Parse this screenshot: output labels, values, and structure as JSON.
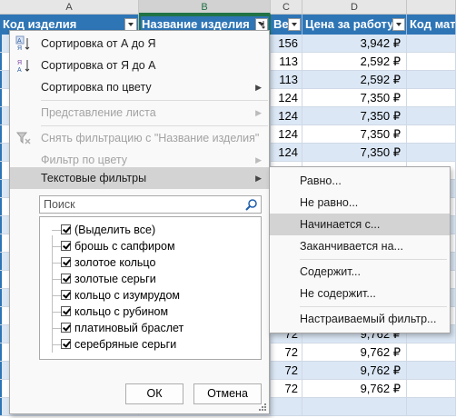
{
  "columns": {
    "letters": [
      "A",
      "B",
      "C",
      "D",
      ""
    ],
    "headers": [
      "Код изделия",
      "Название изделия",
      "Ве",
      "Цена за работу",
      "Код мат"
    ]
  },
  "rows": [
    {
      "c": "156",
      "d": "3,942 ₽"
    },
    {
      "c": "113",
      "d": "2,592 ₽"
    },
    {
      "c": "113",
      "d": "2,592 ₽"
    },
    {
      "c": "124",
      "d": "7,350 ₽"
    },
    {
      "c": "124",
      "d": "7,350 ₽"
    },
    {
      "c": "124",
      "d": "7,350 ₽"
    },
    {
      "c": "124",
      "d": "7,350 ₽"
    },
    {
      "c": "",
      "d": ""
    },
    {
      "c": "",
      "d": ""
    },
    {
      "c": "",
      "d": ""
    },
    {
      "c": "",
      "d": ""
    },
    {
      "c": "",
      "d": ""
    },
    {
      "c": "",
      "d": ""
    },
    {
      "c": "",
      "d": ""
    },
    {
      "c": "",
      "d": ""
    },
    {
      "c": "",
      "d": ""
    },
    {
      "c": "72",
      "d": "9,762 ₽"
    },
    {
      "c": "72",
      "d": "9,762 ₽"
    },
    {
      "c": "72",
      "d": "9,762 ₽"
    },
    {
      "c": "72",
      "d": "9,762 ₽"
    },
    {
      "c": "",
      "d": ""
    }
  ],
  "filter_menu": {
    "sort_az": "Сортировка от А до Я",
    "sort_za": "Сортировка от Я до А",
    "sort_color": "Сортировка по цвету",
    "sheet_view": "Представление листа",
    "clear_filter": "Снять фильтрацию с \"Название изделия\"",
    "filter_color": "Фильтр по цвету",
    "text_filters": "Текстовые фильтры",
    "search_placeholder": "Поиск",
    "items": [
      {
        "label": "(Выделить все)",
        "checked": true
      },
      {
        "label": "брошь с сапфиром",
        "checked": true
      },
      {
        "label": "золотое кольцо",
        "checked": true
      },
      {
        "label": "золотые серьги",
        "checked": true
      },
      {
        "label": "кольцо с изумрудом",
        "checked": true
      },
      {
        "label": "кольцо с рубином",
        "checked": true
      },
      {
        "label": "платиновый браслет",
        "checked": true
      },
      {
        "label": "серебряные серьги",
        "checked": true
      }
    ],
    "ok": "ОК",
    "cancel": "Отмена"
  },
  "submenu": {
    "equals": "Равно...",
    "not_equals": "Не равно...",
    "begins_with": "Начинается с...",
    "ends_with": "Заканчивается на...",
    "contains": "Содержит...",
    "not_contains": "Не содержит...",
    "custom": "Настраиваемый фильтр..."
  },
  "colors": {
    "header": "#2e75b6",
    "band": "#dbe7f5",
    "menu_highlight": "#d3d3d3"
  }
}
